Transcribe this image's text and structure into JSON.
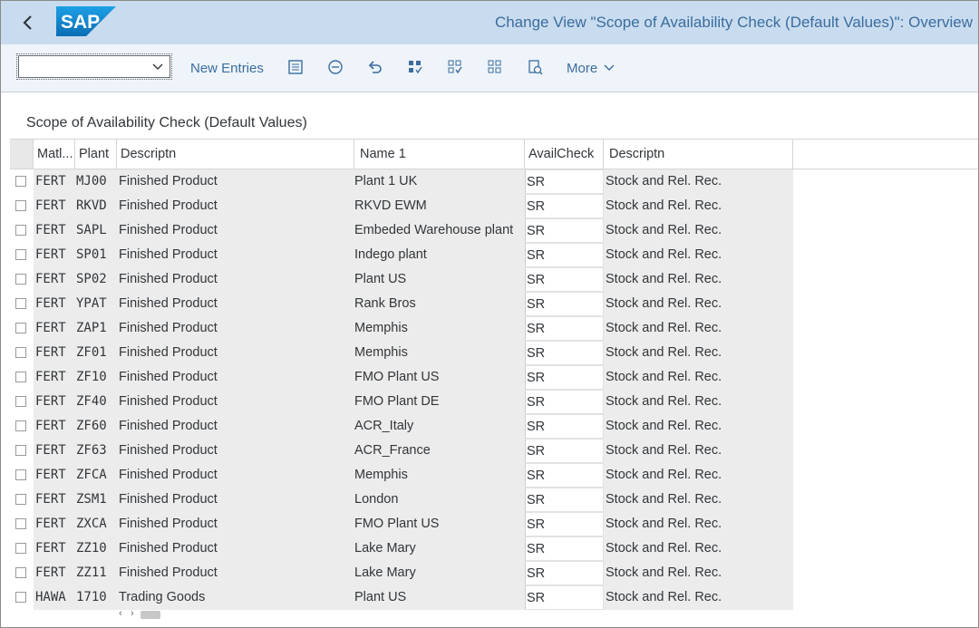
{
  "header": {
    "title": "Change View \"Scope of Availability Check (Default Values)\": Overview",
    "logo_text": "SAP",
    "colors": {
      "bar": "#c9dcef",
      "logo": "#1c86d1",
      "title": "#3b6d9e"
    }
  },
  "toolbar": {
    "select_value": "",
    "new_entries": "New Entries",
    "more": "More",
    "icons": [
      "details-icon",
      "delete-icon",
      "undo-icon",
      "select-all-icon",
      "select-block-icon",
      "deselect-all-icon",
      "print-icon"
    ]
  },
  "section": {
    "title": "Scope of Availability Check (Default Values)"
  },
  "table": {
    "columns": [
      "Matl...",
      "Plant",
      "Descriptn",
      "Name 1",
      "AvailCheck",
      "Descriptn"
    ],
    "rows": [
      {
        "matl": "FERT",
        "plant": "MJ00",
        "desc": "Finished Product",
        "name": "Plant 1 UK",
        "avail": "SR",
        "adesc": "Stock and Rel. Rec."
      },
      {
        "matl": "FERT",
        "plant": "RKVD",
        "desc": "Finished Product",
        "name": "RKVD EWM",
        "avail": "SR",
        "adesc": "Stock and Rel. Rec."
      },
      {
        "matl": "FERT",
        "plant": "SAPL",
        "desc": "Finished Product",
        "name": "Embeded Warehouse plant",
        "avail": "SR",
        "adesc": "Stock and Rel. Rec."
      },
      {
        "matl": "FERT",
        "plant": "SP01",
        "desc": "Finished Product",
        "name": "Indego plant",
        "avail": "SR",
        "adesc": "Stock and Rel. Rec."
      },
      {
        "matl": "FERT",
        "plant": "SP02",
        "desc": "Finished Product",
        "name": "Plant US",
        "avail": "SR",
        "adesc": "Stock and Rel. Rec."
      },
      {
        "matl": "FERT",
        "plant": "YPAT",
        "desc": "Finished Product",
        "name": "Rank Bros",
        "avail": "SR",
        "adesc": "Stock and Rel. Rec."
      },
      {
        "matl": "FERT",
        "plant": "ZAP1",
        "desc": "Finished Product",
        "name": "Memphis",
        "avail": "SR",
        "adesc": "Stock and Rel. Rec."
      },
      {
        "matl": "FERT",
        "plant": "ZF01",
        "desc": "Finished Product",
        "name": "Memphis",
        "avail": "SR",
        "adesc": "Stock and Rel. Rec."
      },
      {
        "matl": "FERT",
        "plant": "ZF10",
        "desc": "Finished Product",
        "name": "FMO Plant US",
        "avail": "SR",
        "adesc": "Stock and Rel. Rec."
      },
      {
        "matl": "FERT",
        "plant": "ZF40",
        "desc": "Finished Product",
        "name": "FMO Plant DE",
        "avail": "SR",
        "adesc": "Stock and Rel. Rec."
      },
      {
        "matl": "FERT",
        "plant": "ZF60",
        "desc": "Finished Product",
        "name": "ACR_Italy",
        "avail": "SR",
        "adesc": "Stock and Rel. Rec."
      },
      {
        "matl": "FERT",
        "plant": "ZF63",
        "desc": "Finished Product",
        "name": "ACR_France",
        "avail": "SR",
        "adesc": "Stock and Rel. Rec."
      },
      {
        "matl": "FERT",
        "plant": "ZFCA",
        "desc": "Finished Product",
        "name": "Memphis",
        "avail": "SR",
        "adesc": "Stock and Rel. Rec."
      },
      {
        "matl": "FERT",
        "plant": "ZSM1",
        "desc": "Finished Product",
        "name": "London",
        "avail": "SR",
        "adesc": "Stock and Rel. Rec."
      },
      {
        "matl": "FERT",
        "plant": "ZXCA",
        "desc": "Finished Product",
        "name": "FMO Plant US",
        "avail": "SR",
        "adesc": "Stock and Rel. Rec."
      },
      {
        "matl": "FERT",
        "plant": "ZZ10",
        "desc": "Finished Product",
        "name": "Lake Mary",
        "avail": "SR",
        "adesc": "Stock and Rel. Rec."
      },
      {
        "matl": "FERT",
        "plant": "ZZ11",
        "desc": "Finished Product",
        "name": "Lake Mary",
        "avail": "SR",
        "adesc": "Stock and Rel. Rec."
      },
      {
        "matl": "HAWA",
        "plant": "1710",
        "desc": "Trading Goods",
        "name": "Plant US",
        "avail": "SR",
        "adesc": "Stock and Rel. Rec."
      }
    ]
  }
}
